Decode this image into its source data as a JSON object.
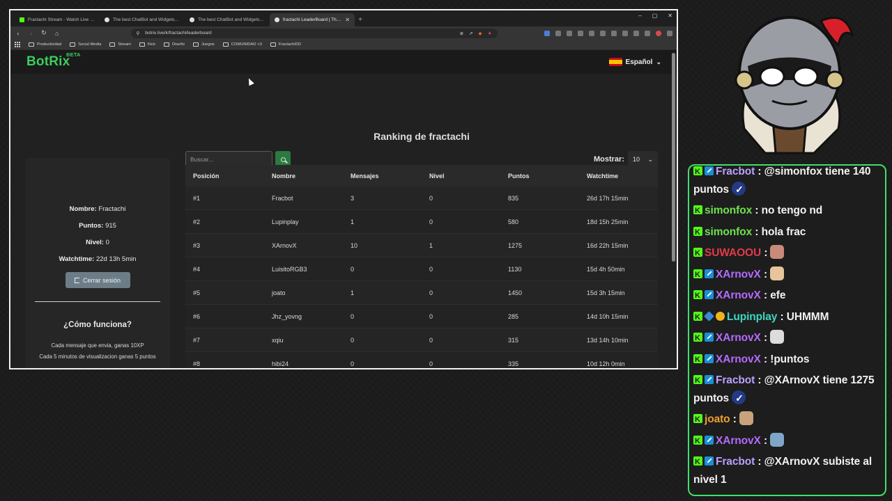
{
  "browser": {
    "tabs": [
      {
        "title": "Fractachi Stream - Watch Live on Kick",
        "fav": "kick"
      },
      {
        "title": "The best ChatBot and Widgets for Ki",
        "fav": "bot"
      },
      {
        "title": "The best ChatBot and Widgets for Ki",
        "fav": "bot"
      },
      {
        "title": "fractachi LeaderBoard | The best",
        "fav": "bot",
        "active": true
      }
    ],
    "new_tab": "+",
    "window_controls": [
      "–",
      "▢",
      "✕"
    ],
    "url": "botrix.live/k/fractachi/leaderboard",
    "bookmarks": [
      "Productividad",
      "Social Media",
      "Stream",
      "Kick",
      "Diseño",
      "Juegos",
      "COMUNIDAD <3",
      "FractachiDD"
    ]
  },
  "site": {
    "logo": "BotRix",
    "beta": "BETA",
    "language": "Español",
    "title": "Ranking de fractachi",
    "search_placeholder": "Buscar...",
    "show_label": "Mostrar:",
    "show_value": "10"
  },
  "profile": {
    "name_label": "Nombre:",
    "name": "Fractachi",
    "points_label": "Puntos:",
    "points": "915",
    "level_label": "Nivel:",
    "level": "0",
    "watchtime_label": "Watchtime:",
    "watchtime": "22d 13h 5min",
    "logout": "Cerrar sesión",
    "how_title": "¿Cómo funciona?",
    "how_line1": "Cada mensaje que envia, ganas 10XP",
    "how_line2": "Cada 5 minutos de visualizacion ganas 5 puntos"
  },
  "table": {
    "headers": [
      "Posición",
      "Nombre",
      "Mensajes",
      "Nivel",
      "Puntos",
      "Watchtime"
    ],
    "rows": [
      [
        "#1",
        "Fracbot",
        "3",
        "0",
        "835",
        "26d 17h 15min"
      ],
      [
        "#2",
        "Lupinplay",
        "1",
        "0",
        "580",
        "18d 15h 25min"
      ],
      [
        "#3",
        "XArnovX",
        "10",
        "1",
        "1275",
        "16d 22h 15min"
      ],
      [
        "#4",
        "LuisitoRGB3",
        "0",
        "0",
        "1130",
        "15d 4h 50min"
      ],
      [
        "#5",
        "joato",
        "1",
        "0",
        "1450",
        "15d 3h 15min"
      ],
      [
        "#6",
        "Jhz_yovng",
        "0",
        "0",
        "285",
        "14d 10h 15min"
      ],
      [
        "#7",
        "xqiu",
        "0",
        "0",
        "315",
        "13d 14h 10min"
      ],
      [
        "#8",
        "hibi24",
        "0",
        "0",
        "335",
        "10d 12h 0min"
      ]
    ]
  },
  "chat": [
    {
      "badges": [
        "kick",
        "mod"
      ],
      "user": "Fracbot",
      "color": "#b9a1ff",
      "text": ": @simonfox tiene 140 puntos",
      "verified": true
    },
    {
      "badges": [
        "kick"
      ],
      "user": "simonfox",
      "color": "#6fe24f",
      "text": ": no tengo nd"
    },
    {
      "badges": [
        "kick"
      ],
      "user": "simonfox",
      "color": "#6fe24f",
      "text": ": hola frac"
    },
    {
      "badges": [
        "kick"
      ],
      "user": "SUWAOOU",
      "color": "#e23a4a",
      "text": ":",
      "emote": "#c98a7a"
    },
    {
      "badges": [
        "kick",
        "mod"
      ],
      "user": "XArnovX",
      "color": "#b46bff",
      "text": ":",
      "emote": "#e8c49a"
    },
    {
      "badges": [
        "kick",
        "mod"
      ],
      "user": "XArnovX",
      "color": "#b46bff",
      "text": ": efe"
    },
    {
      "badges": [
        "kick",
        "cube",
        "coin"
      ],
      "user": "Lupinplay",
      "color": "#3fd6c2",
      "text": ": UHMMM"
    },
    {
      "badges": [
        "kick",
        "mod"
      ],
      "user": "XArnovX",
      "color": "#b46bff",
      "text": ":",
      "emote": "#dcdcdc"
    },
    {
      "badges": [
        "kick",
        "mod"
      ],
      "user": "XArnovX",
      "color": "#b46bff",
      "text": ": !puntos"
    },
    {
      "badges": [
        "kick",
        "mod"
      ],
      "user": "Fracbot",
      "color": "#b9a1ff",
      "text": ": @XArnovX tiene 1275 puntos",
      "verified": true
    },
    {
      "badges": [
        "kick"
      ],
      "user": "joato",
      "color": "#f0a030",
      "text": ":",
      "emote": "#c7a27a"
    },
    {
      "badges": [
        "kick",
        "mod"
      ],
      "user": "XArnovX",
      "color": "#b46bff",
      "text": ":",
      "emote": "#7fa6c9"
    },
    {
      "badges": [
        "kick",
        "mod"
      ],
      "user": "Fracbot",
      "color": "#b9a1ff",
      "text": ": @XArnovX subiste al nivel 1"
    }
  ]
}
